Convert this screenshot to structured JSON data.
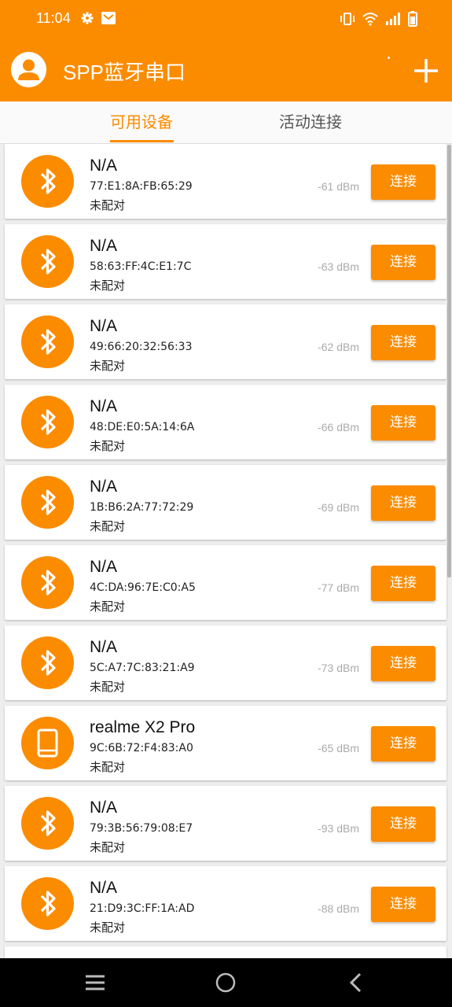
{
  "status_bar": {
    "time": "11:04",
    "left_icons": [
      "gear-icon",
      "mail-icon"
    ],
    "right_icons": [
      "vibrate-icon",
      "wifi-icon",
      "signal-icon",
      "battery-icon"
    ]
  },
  "app_bar": {
    "title": "SPP蓝牙串口",
    "avatar_icon": "account-icon",
    "add_icon": "plus-icon"
  },
  "tabs": {
    "available": "可用设备",
    "active": "活动连接",
    "selected": "available"
  },
  "devices": [
    {
      "name": "N/A",
      "address": "77:E1:8A:FB:65:29",
      "status": "未配对",
      "rssi": "-61 dBm",
      "icon": "bluetooth-icon",
      "button": "连接"
    },
    {
      "name": "N/A",
      "address": "58:63:FF:4C:E1:7C",
      "status": "未配对",
      "rssi": "-63 dBm",
      "icon": "bluetooth-icon",
      "button": "连接"
    },
    {
      "name": "N/A",
      "address": "49:66:20:32:56:33",
      "status": "未配对",
      "rssi": "-62 dBm",
      "icon": "bluetooth-icon",
      "button": "连接"
    },
    {
      "name": "N/A",
      "address": "48:DE:E0:5A:14:6A",
      "status": "未配对",
      "rssi": "-66 dBm",
      "icon": "bluetooth-icon",
      "button": "连接"
    },
    {
      "name": "N/A",
      "address": "1B:B6:2A:77:72:29",
      "status": "未配对",
      "rssi": "-69 dBm",
      "icon": "bluetooth-icon",
      "button": "连接"
    },
    {
      "name": "N/A",
      "address": "4C:DA:96:7E:C0:A5",
      "status": "未配对",
      "rssi": "-77 dBm",
      "icon": "bluetooth-icon",
      "button": "连接"
    },
    {
      "name": "N/A",
      "address": "5C:A7:7C:83:21:A9",
      "status": "未配对",
      "rssi": "-73 dBm",
      "icon": "bluetooth-icon",
      "button": "连接"
    },
    {
      "name": "realme X2 Pro",
      "address": "9C:6B:72:F4:83:A0",
      "status": "未配对",
      "rssi": "-65 dBm",
      "icon": "phone-icon",
      "button": "连接"
    },
    {
      "name": "N/A",
      "address": "79:3B:56:79:08:E7",
      "status": "未配对",
      "rssi": "-93 dBm",
      "icon": "bluetooth-icon",
      "button": "连接"
    },
    {
      "name": "N/A",
      "address": "21:D9:3C:FF:1A:AD",
      "status": "未配对",
      "rssi": "-88 dBm",
      "icon": "bluetooth-icon",
      "button": "连接"
    }
  ],
  "nav_bar": {
    "icons": [
      "menu-icon",
      "home-icon",
      "back-icon"
    ]
  },
  "colors": {
    "accent": "#fb8c00",
    "background": "#eeeeee"
  }
}
